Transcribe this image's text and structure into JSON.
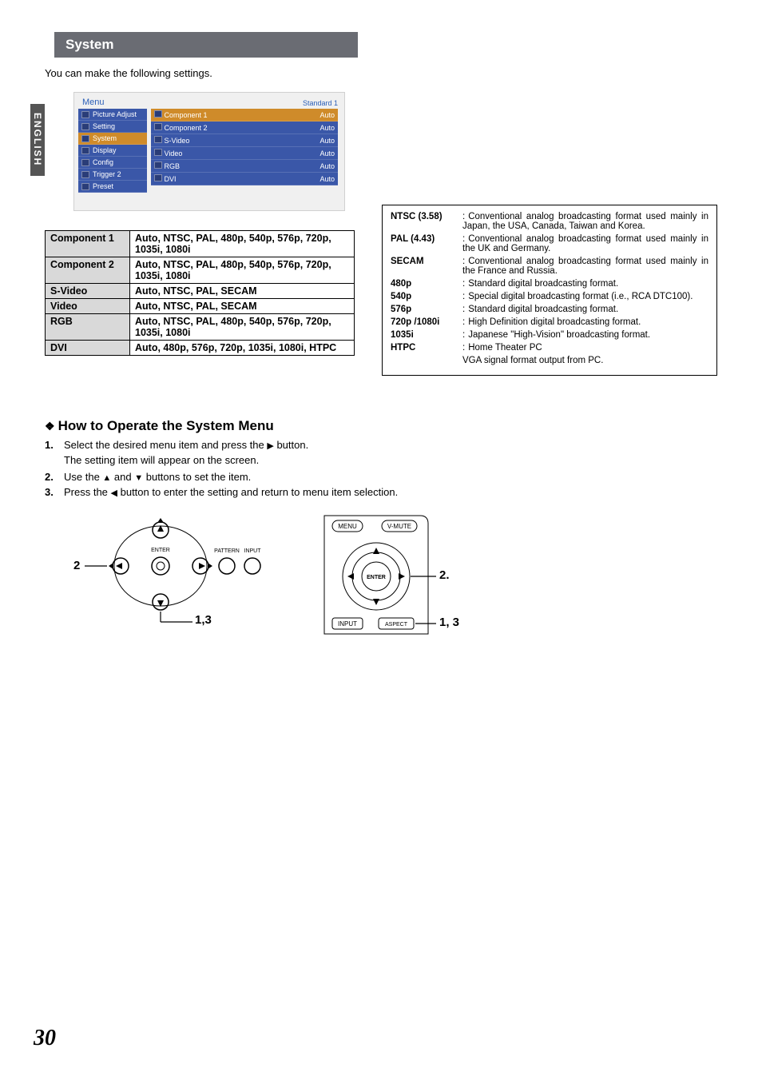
{
  "side_tab": "ENGLISH",
  "header": "System",
  "intro": "You can make the following settings.",
  "menu_mock": {
    "title": "Menu",
    "standard": "Standard 1",
    "left": [
      {
        "label": "Picture Adjust",
        "selected": false
      },
      {
        "label": "Setting",
        "selected": false
      },
      {
        "label": "System",
        "selected": true
      },
      {
        "label": "Display",
        "selected": false
      },
      {
        "label": "Config",
        "selected": false
      },
      {
        "label": "Trigger 2",
        "selected": false
      },
      {
        "label": "Preset",
        "selected": false
      }
    ],
    "right": [
      {
        "label": "Component 1",
        "value": "Auto",
        "selected": true
      },
      {
        "label": "Component 2",
        "value": "Auto",
        "selected": false
      },
      {
        "label": "S-Video",
        "value": "Auto",
        "selected": false
      },
      {
        "label": "Video",
        "value": "Auto",
        "selected": false
      },
      {
        "label": "RGB",
        "value": "Auto",
        "selected": false
      },
      {
        "label": "DVI",
        "value": "Auto",
        "selected": false
      }
    ]
  },
  "formats": [
    {
      "name": "Component 1",
      "opts": "Auto, NTSC, PAL, 480p, 540p, 576p, 720p, 1035i, 1080i"
    },
    {
      "name": "Component 2",
      "opts": "Auto, NTSC, PAL, 480p, 540p, 576p, 720p, 1035i, 1080i"
    },
    {
      "name": "S-Video",
      "opts": "Auto, NTSC, PAL, SECAM"
    },
    {
      "name": "Video",
      "opts": "Auto, NTSC, PAL, SECAM"
    },
    {
      "name": "RGB",
      "opts": "Auto, NTSC, PAL, 480p, 540p, 576p, 720p, 1035i, 1080i"
    },
    {
      "name": "DVI",
      "opts": "Auto, 480p, 576p, 720p, 1035i, 1080i, HTPC"
    }
  ],
  "definitions": [
    {
      "term": "NTSC (3.58)",
      "desc": "Conventional analog broadcasting format used mainly in Japan, the USA, Canada, Taiwan and Korea."
    },
    {
      "term": "PAL (4.43)",
      "desc": "Conventional analog broadcasting format used mainly in the UK and Germany."
    },
    {
      "term": "SECAM",
      "desc": "Conventional analog broadcasting format used mainly in the France and Russia."
    },
    {
      "term": "480p",
      "desc": "Standard digital broadcasting format."
    },
    {
      "term": "540p",
      "desc": "Special digital broadcasting format (i.e., RCA DTC100)."
    },
    {
      "term": "576p",
      "desc": "Standard digital broadcasting format."
    },
    {
      "term": "720p /1080i",
      "desc": "High Definition digital broadcasting format."
    },
    {
      "term": "1035i",
      "desc": "Japanese \"High-Vision\" broadcasting format."
    },
    {
      "term": "HTPC",
      "desc": "Home Theater PC"
    },
    {
      "term": "",
      "desc": "VGA signal format output from PC."
    }
  ],
  "howto": {
    "heading": "How to Operate the System Menu",
    "steps": [
      {
        "num": "1.",
        "text_a": "Select the desired menu item and press the ",
        "text_b": " button.",
        "sub": "The setting item will appear on the screen."
      },
      {
        "num": "2.",
        "text_a": "Use the ",
        "mid": " and ",
        "text_b": " buttons to set the item."
      },
      {
        "num": "3.",
        "text_a": "Press the ",
        "text_b": " button to enter the setting and return to menu item selection."
      }
    ]
  },
  "diag_left": {
    "ann_left": "2",
    "ann_bottom": "1,3",
    "labels": {
      "enter": "ENTER",
      "pattern": "PATTERN",
      "input": "INPUT"
    }
  },
  "diag_right": {
    "ann_right": "2.",
    "ann_bottom": "1, 3",
    "labels": {
      "menu": "MENU",
      "vmute": "V-MUTE",
      "enter": "ENTER",
      "input": "INPUT",
      "aspect": "ASPECT"
    }
  },
  "page_number": "30"
}
